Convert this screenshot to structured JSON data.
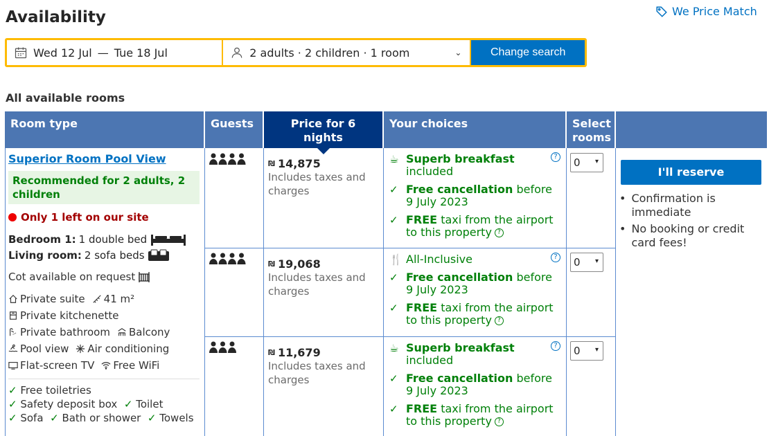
{
  "header": {
    "title": "Availability",
    "price_match": "We Price Match"
  },
  "search": {
    "check_in": "Wed 12 Jul",
    "separator": "—",
    "check_out": "Tue 18 Jul",
    "guests": "2 adults · 2 children · 1 room",
    "change_button": "Change search"
  },
  "section_title": "All available rooms",
  "table_headers": {
    "room_type": "Room type",
    "guests": "Guests",
    "price": "Price for 6 nights",
    "choices": "Your choices",
    "select": "Select rooms"
  },
  "room": {
    "name": "Superior Room Pool View",
    "recommended": "Recommended for 2 adults, 2 children",
    "scarcity": "Only 1 left on our site",
    "bedroom_label": "Bedroom 1:",
    "bedroom_value": "1 double bed",
    "living_label": "Living room:",
    "living_value": "2 sofa beds",
    "cot": "Cot available on request",
    "facilities": [
      "Private suite",
      "41 m²",
      "Private kitchenette",
      "Private bathroom",
      "Balcony",
      "Pool view",
      "Air conditioning",
      "Flat-screen TV",
      "Free WiFi"
    ],
    "amenities": [
      "Free toiletries",
      "Safety deposit box",
      "Toilet",
      "Sofa",
      "Bath or shower",
      "Towels"
    ]
  },
  "options": [
    {
      "guests_count": 4,
      "currency": "₪",
      "price": "14,875",
      "price_note": "Includes taxes and charges",
      "meal_bold": "Superb breakfast",
      "meal_rest": "included",
      "cancel_bold": "Free cancellation",
      "cancel_rest": "before 9 July 2023",
      "taxi_bold": "FREE",
      "taxi_rest": "taxi from the airport to this property",
      "selected": "0"
    },
    {
      "guests_count": 4,
      "currency": "₪",
      "price": "19,068",
      "price_note": "Includes taxes and charges",
      "meal_bold": "",
      "meal_rest": "All-Inclusive",
      "cancel_bold": "Free cancellation",
      "cancel_rest": "before 9 July 2023",
      "taxi_bold": "FREE",
      "taxi_rest": "taxi from the airport to this property",
      "selected": "0"
    },
    {
      "guests_count": 3,
      "currency": "₪",
      "price": "11,679",
      "price_note": "Includes taxes and charges",
      "meal_bold": "Superb breakfast",
      "meal_rest": "included",
      "cancel_bold": "Free cancellation",
      "cancel_rest": "before 9 July 2023",
      "taxi_bold": "FREE",
      "taxi_rest": "taxi from the airport to this property",
      "selected": "0"
    }
  ],
  "reserve": {
    "button": "I'll reserve",
    "notes": [
      "Confirmation is immediate",
      "No booking or credit card fees!"
    ]
  }
}
